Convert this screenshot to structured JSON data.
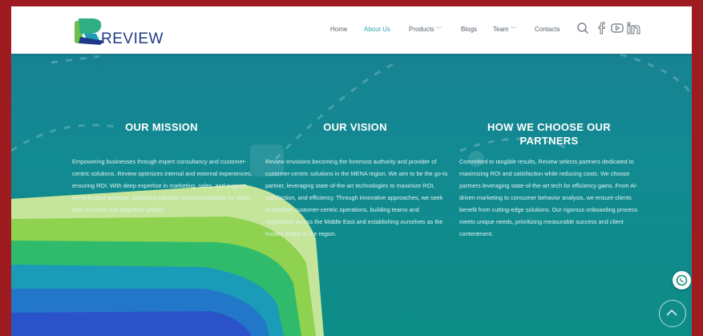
{
  "brand": {
    "name": "REVIEW"
  },
  "nav": {
    "items": [
      {
        "label": "Home",
        "active": false
      },
      {
        "label": "About Us",
        "active": true
      },
      {
        "label": "Products",
        "active": false,
        "dropdown": true
      },
      {
        "label": "Blogs",
        "active": false
      },
      {
        "label": "Team",
        "active": false,
        "dropdown": true
      },
      {
        "label": "Contacts",
        "active": false
      }
    ],
    "icons": [
      "search-icon",
      "facebook-icon",
      "youtube-icon",
      "linkedin-icon"
    ]
  },
  "sections": [
    {
      "title": "OUR MISSION",
      "text": "Empowering businesses through expert consultancy and customer-centric solutions. Review optimizes internal and external experiences, ensuring ROI. With deep expertise in marketing, sales, and support, we're trusted advisors, delivering tailored recommendations for short-term success and long-term growth."
    },
    {
      "title": "OUR VISION",
      "text": "Review envisions becoming the foremost authority and provider of customer-centric solutions in the MENA region. We aim to be the go-to partner, leveraging state-of-the-art technologies to maximize ROI, satisfaction, and efficiency. Through innovative approaches, we seek to redefine customer-centric operations, building teams and experience across the Middle East and establishing ourselves as the trusted leader in the region."
    },
    {
      "title": "HOW WE CHOOSE OUR PARTNERS",
      "text": "Committed to tangible results, Review selects partners dedicated to maximizing ROI and satisfaction while reducing costs. We choose partners leveraging state-of-the-art tech for efficiency gains. From AI-driven marketing to consumer behavior analysis, we ensure clients benefit from cutting-edge solutions. Our rigorous onboarding process meets unique needs, prioritizing measurable success and client contentment."
    }
  ],
  "floating": {
    "whatsapp_icon": "whatsapp-icon",
    "scroll_top_icon": "chevron-up-icon"
  },
  "colors": {
    "background_top": "#1a7f92",
    "background_bottom": "#0e8c86",
    "accent": "#2aa8b7",
    "frame": "#9e1c1f",
    "logo_navy": "#1d3a8a",
    "logo_green": "#6cc04a"
  }
}
